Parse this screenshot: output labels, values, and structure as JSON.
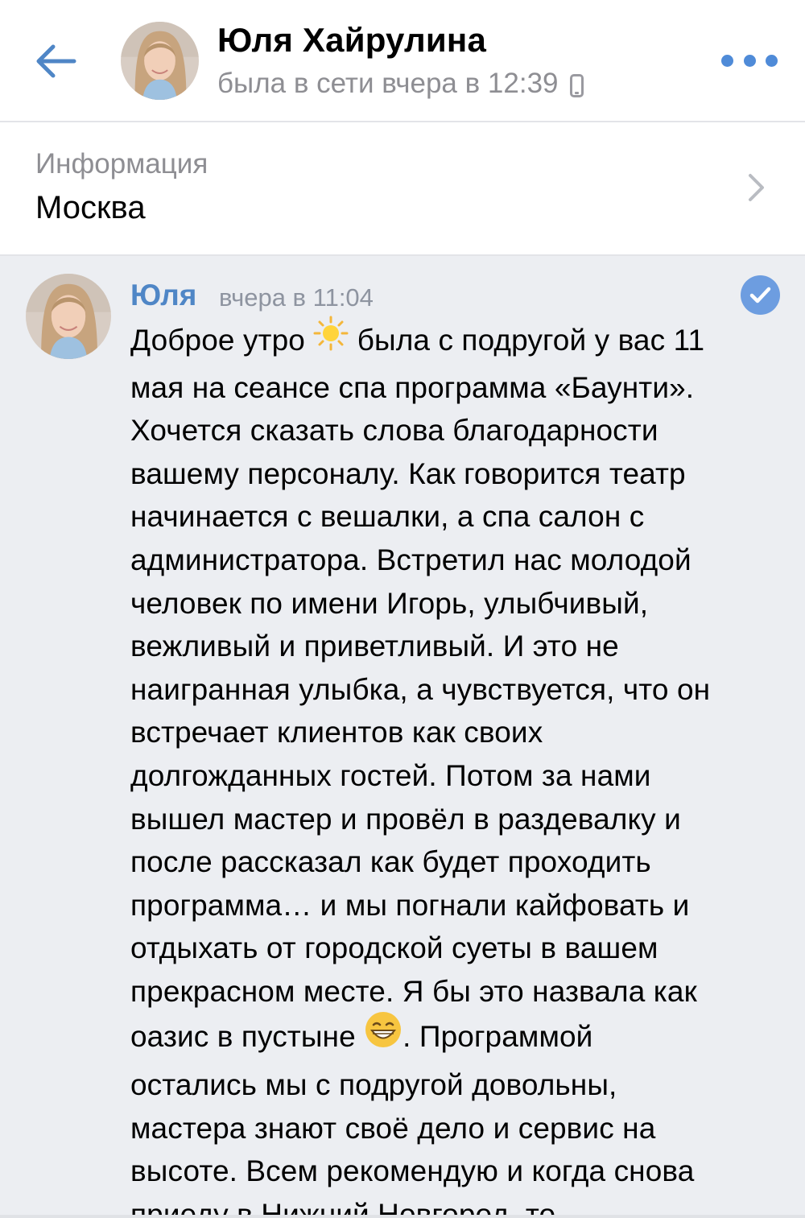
{
  "header": {
    "title": "Юля Хайрулина",
    "status": "была в сети вчера в 12:39"
  },
  "info": {
    "label": "Информация",
    "value": "Москва"
  },
  "message": {
    "author": "Юля",
    "time": "вчера в 11:04",
    "text_part1": "Доброе утро ",
    "text_part2": " была с подругой у вас 11\nмая на сеансе спа программа «Баунти».\nХочется сказать слова благодарности\nвашему персоналу. Как говорится театр\nначинается с вешалки, а спа салон с\nадминистратора. Встретил нас молодой\nчеловек по имени Игорь, улыбчивый,\nвежливый и приветливый. И это не\nнаигранная улыбка, а чувствуется, что он\nвстречает клиентов как своих\nдолгожданных гостей. Потом за нами\nвышел мастер и провёл в раздевалку и\nпосле рассказал как будет проходить\nпрограмма… и мы погнали кайфовать и\nотдыхать от городской суеты в вашем\nпрекрасном месте. Я бы это назвала как\nоазис в пустыне ",
    "text_part3": ". Программой\nостались мы с подругой довольны,\nмастера знают своё дело и сервис на\nвысоте. Всем рекомендую и когда снова\nприеду в Нижний Новгород, то",
    "emoji_1": "sun-emoji",
    "emoji_2": "grinning-face-emoji"
  },
  "colors": {
    "accent": "#4f86c6",
    "secondary_text": "#8e8e93",
    "message_background": "#eceef2",
    "read_check": "#6d9de0"
  },
  "icons": [
    "back-arrow-icon",
    "phone-icon",
    "more-icon",
    "chevron-right-icon",
    "read-check-icon"
  ]
}
